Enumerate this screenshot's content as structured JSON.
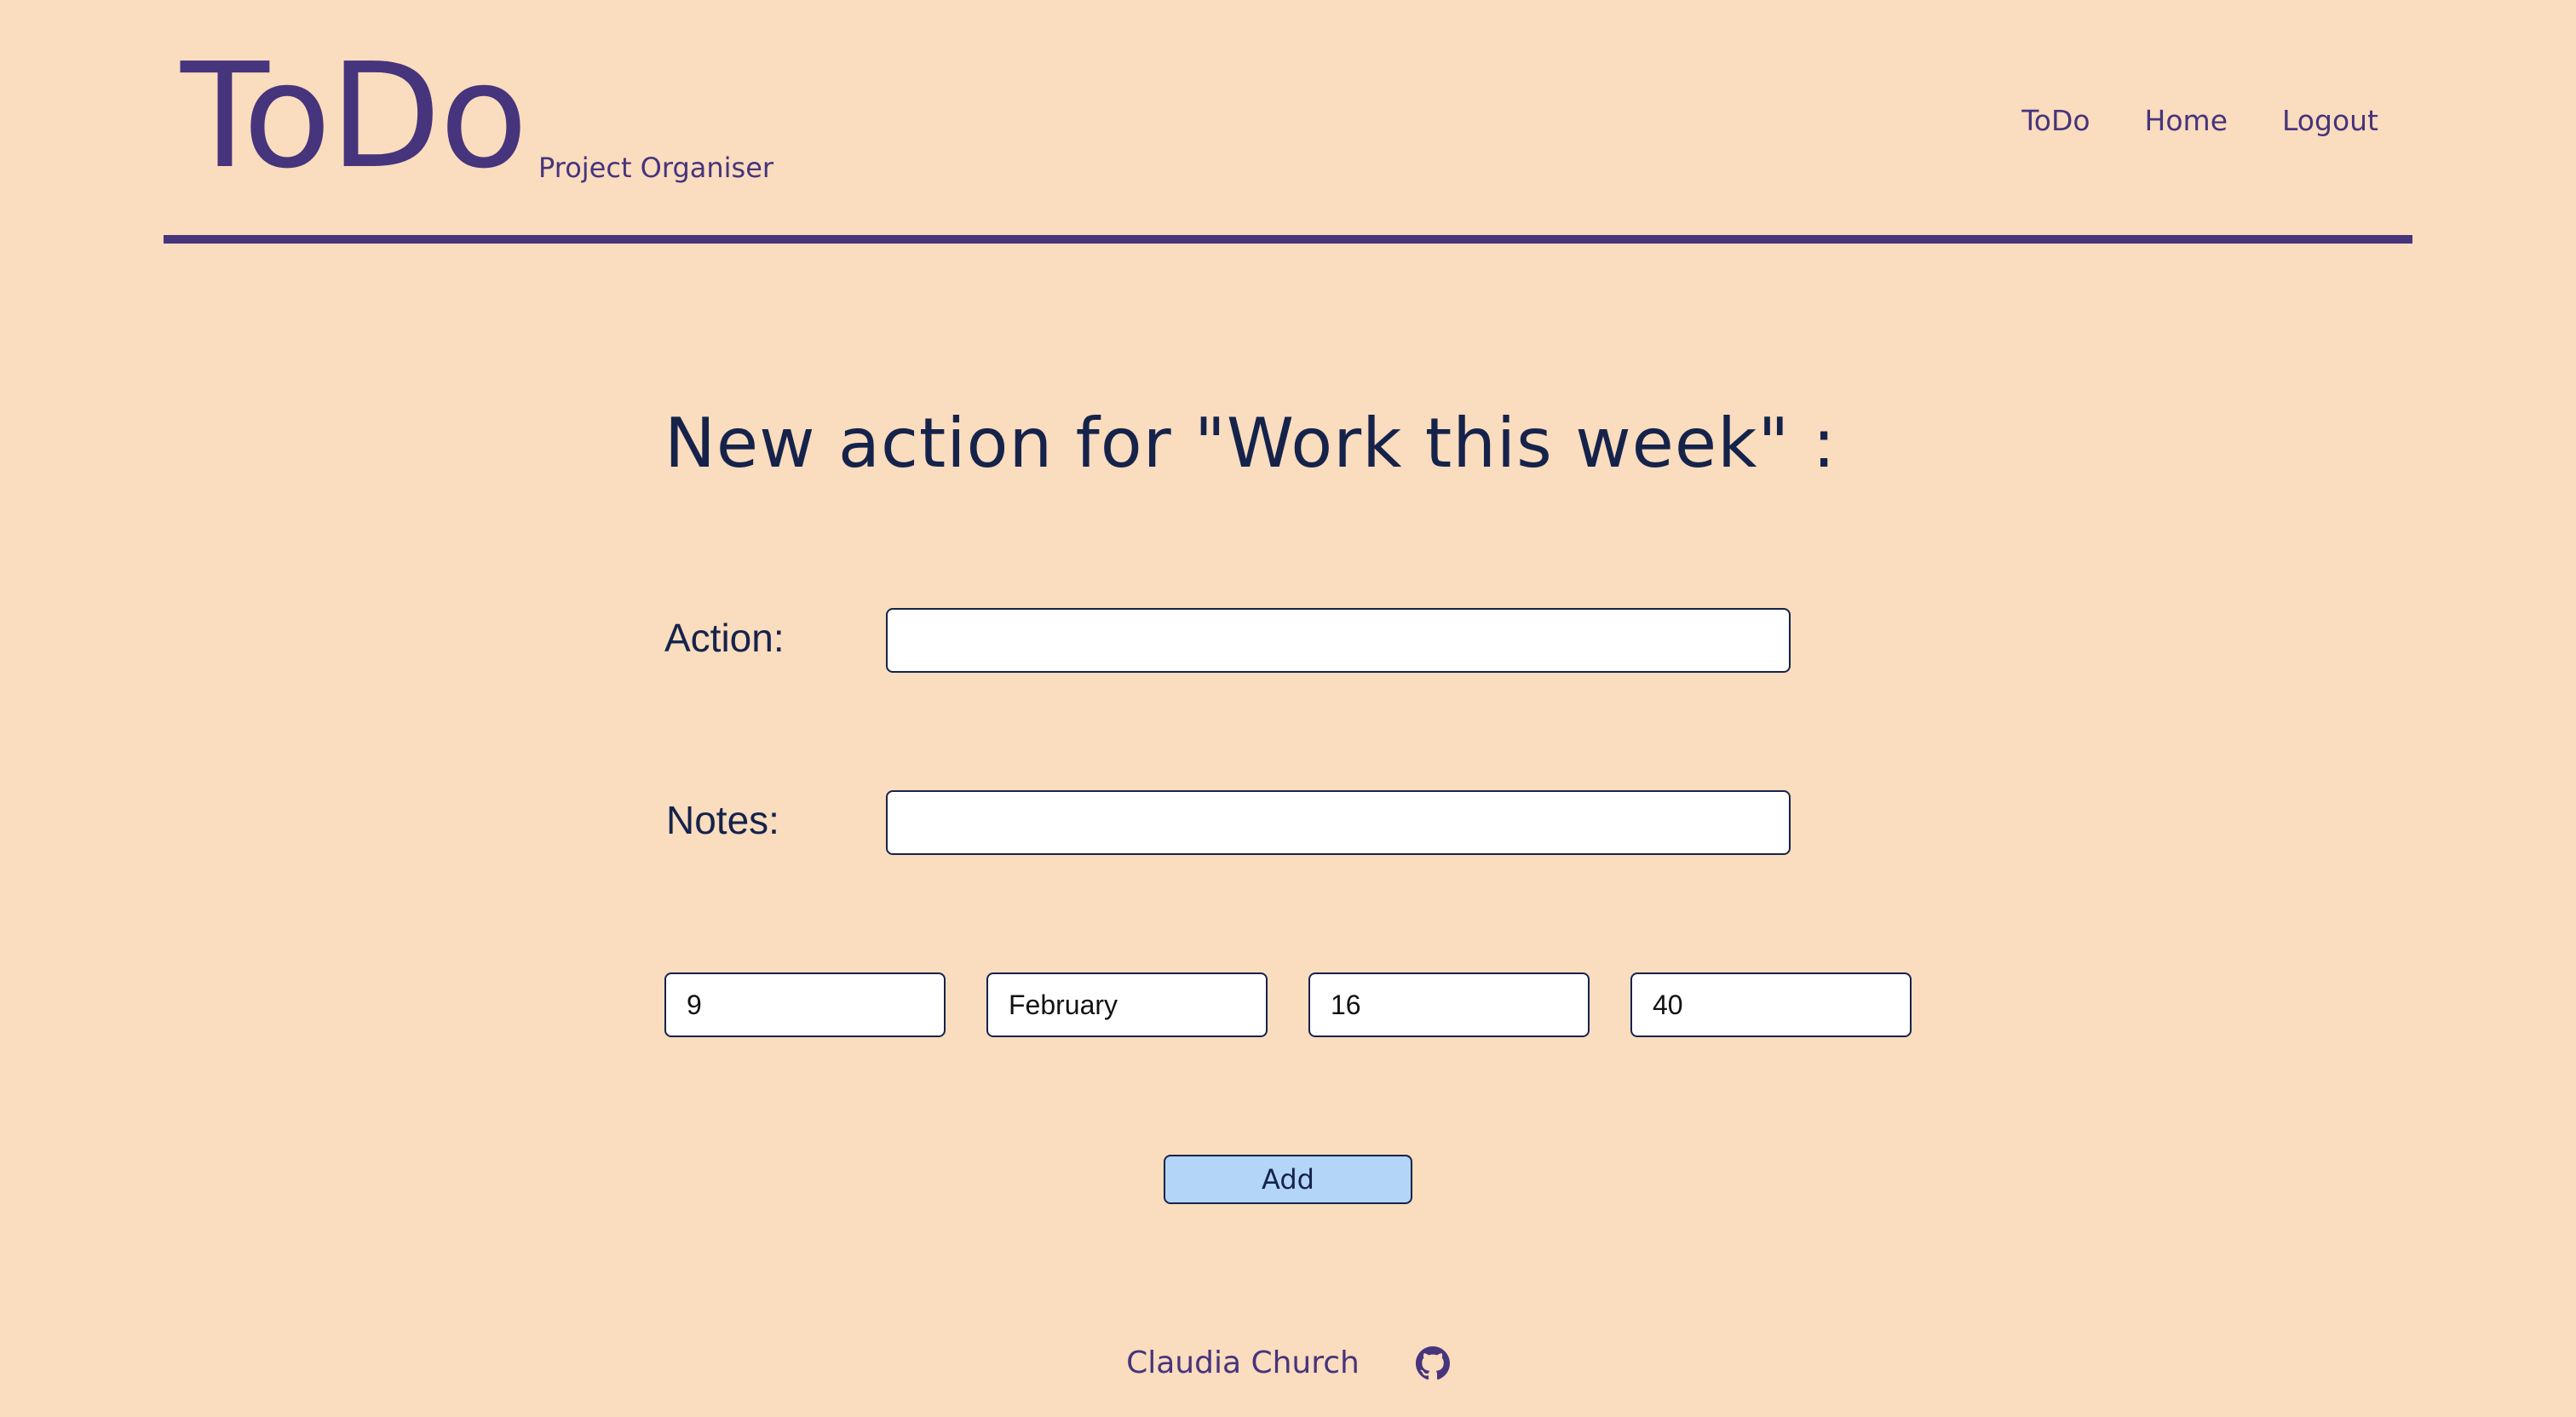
{
  "header": {
    "logo": "ToDo",
    "subtitle": "Project Organiser",
    "nav": {
      "todo": "ToDo",
      "home": "Home",
      "logout": "Logout"
    }
  },
  "form": {
    "title": "New action for \"Work this week\" :",
    "action_label": "Action:",
    "action_value": "",
    "notes_label": "Notes:",
    "notes_value": "",
    "day": "9",
    "month": "February",
    "hour": "16",
    "minute": "40",
    "add_label": "Add"
  },
  "footer": {
    "author": "Claudia Church",
    "github_icon": "github-icon"
  },
  "colors": {
    "background": "#fadcbe",
    "brand": "#46347c",
    "text_dark": "#15234b",
    "button": "#b3d5f7"
  }
}
